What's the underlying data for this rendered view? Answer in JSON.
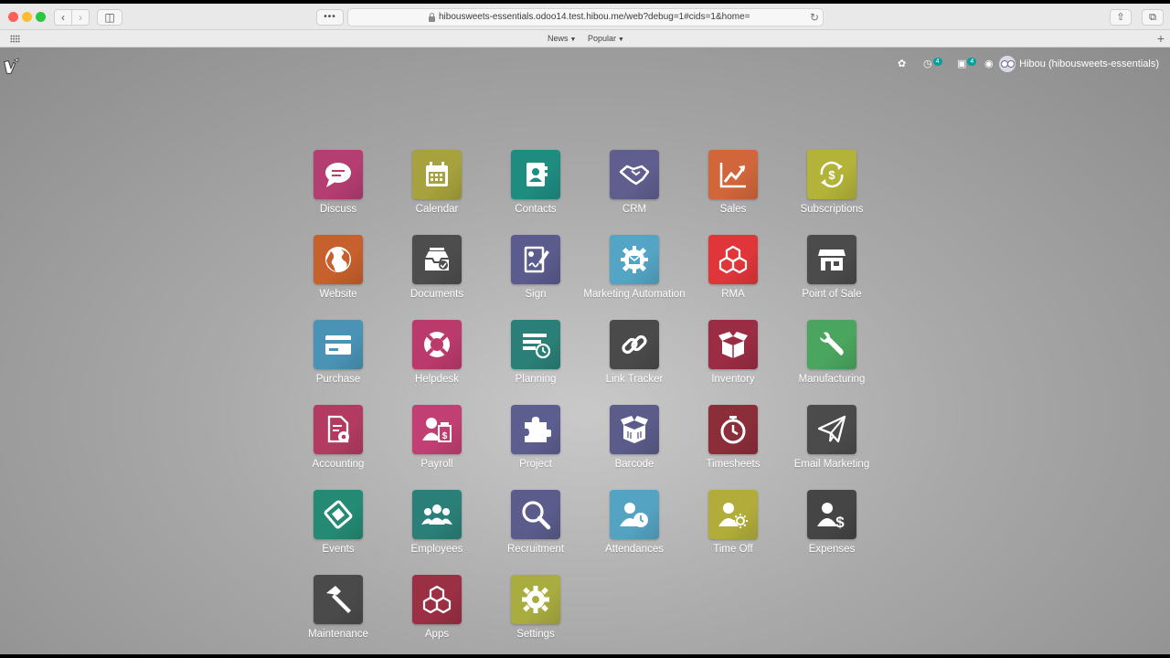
{
  "browser": {
    "url": "hibousweets-essentials.odoo14.test.hibou.me/web?debug=1#cids=1&home=",
    "bookmarks": [
      {
        "label": "News"
      },
      {
        "label": "Popular"
      }
    ]
  },
  "systray": {
    "activity_count": "4",
    "message_count": "4",
    "user_name": "Hibou (hibousweets-essentials)"
  },
  "apps": [
    {
      "label": "Discuss",
      "color": "#b43d72",
      "icon": "chat-bubble-icon"
    },
    {
      "label": "Calendar",
      "color": "#a7a23d",
      "icon": "calendar-icon"
    },
    {
      "label": "Contacts",
      "color": "#1f8c80",
      "icon": "address-book-icon"
    },
    {
      "label": "CRM",
      "color": "#5f5e8f",
      "icon": "handshake-icon"
    },
    {
      "label": "Sales",
      "color": "#d1663a",
      "icon": "trend-chart-icon"
    },
    {
      "label": "Subscriptions",
      "color": "#b3b339",
      "icon": "recurring-dollar-icon"
    },
    {
      "label": "Website",
      "color": "#c6602c",
      "icon": "globe-icon"
    },
    {
      "label": "Documents",
      "color": "#4d4d4d",
      "icon": "inbox-tray-icon"
    },
    {
      "label": "Sign",
      "color": "#5b5b8e",
      "icon": "signed-document-icon"
    },
    {
      "label": "Marketing Automation",
      "color": "#54a5c5",
      "icon": "gear-envelope-icon"
    },
    {
      "label": "RMA",
      "color": "#e0363a",
      "icon": "cubes-icon"
    },
    {
      "label": "Point of Sale",
      "color": "#4b4b4b",
      "icon": "shop-icon"
    },
    {
      "label": "Purchase",
      "color": "#4a93b6",
      "icon": "credit-card-icon"
    },
    {
      "label": "Helpdesk",
      "color": "#ba3a6c",
      "icon": "lifebuoy-icon"
    },
    {
      "label": "Planning",
      "color": "#2a8078",
      "icon": "planning-clock-icon"
    },
    {
      "label": "Link Tracker",
      "color": "#4a4a4a",
      "icon": "link-icon"
    },
    {
      "label": "Inventory",
      "color": "#9a2c43",
      "icon": "open-box-icon"
    },
    {
      "label": "Manufacturing",
      "color": "#4aa55e",
      "icon": "wrench-icon"
    },
    {
      "label": "Accounting",
      "color": "#b33b62",
      "icon": "invoice-gear-icon"
    },
    {
      "label": "Payroll",
      "color": "#c13f72",
      "icon": "user-payslip-icon"
    },
    {
      "label": "Project",
      "color": "#5d5e90",
      "icon": "puzzle-icon"
    },
    {
      "label": "Barcode",
      "color": "#5b5c8a",
      "icon": "barcode-box-icon"
    },
    {
      "label": "Timesheets",
      "color": "#8c2d3a",
      "icon": "stopwatch-icon"
    },
    {
      "label": "Email Marketing",
      "color": "#4b4b4b",
      "icon": "paper-plane-icon"
    },
    {
      "label": "Events",
      "color": "#248a73",
      "icon": "ticket-icon"
    },
    {
      "label": "Employees",
      "color": "#2a8078",
      "icon": "users-icon"
    },
    {
      "label": "Recruitment",
      "color": "#5b5c8c",
      "icon": "magnifier-icon"
    },
    {
      "label": "Attendances",
      "color": "#55a3c3",
      "icon": "user-clock-icon"
    },
    {
      "label": "Time Off",
      "color": "#b2ad3a",
      "icon": "user-sun-icon"
    },
    {
      "label": "Expenses",
      "color": "#454545",
      "icon": "user-dollar-icon"
    },
    {
      "label": "Maintenance",
      "color": "#4a4a4a",
      "icon": "hammer-icon"
    },
    {
      "label": "Apps",
      "color": "#9b2f44",
      "icon": "cubes-icon"
    },
    {
      "label": "Settings",
      "color": "#a9ac3f",
      "icon": "gear-icon"
    }
  ]
}
